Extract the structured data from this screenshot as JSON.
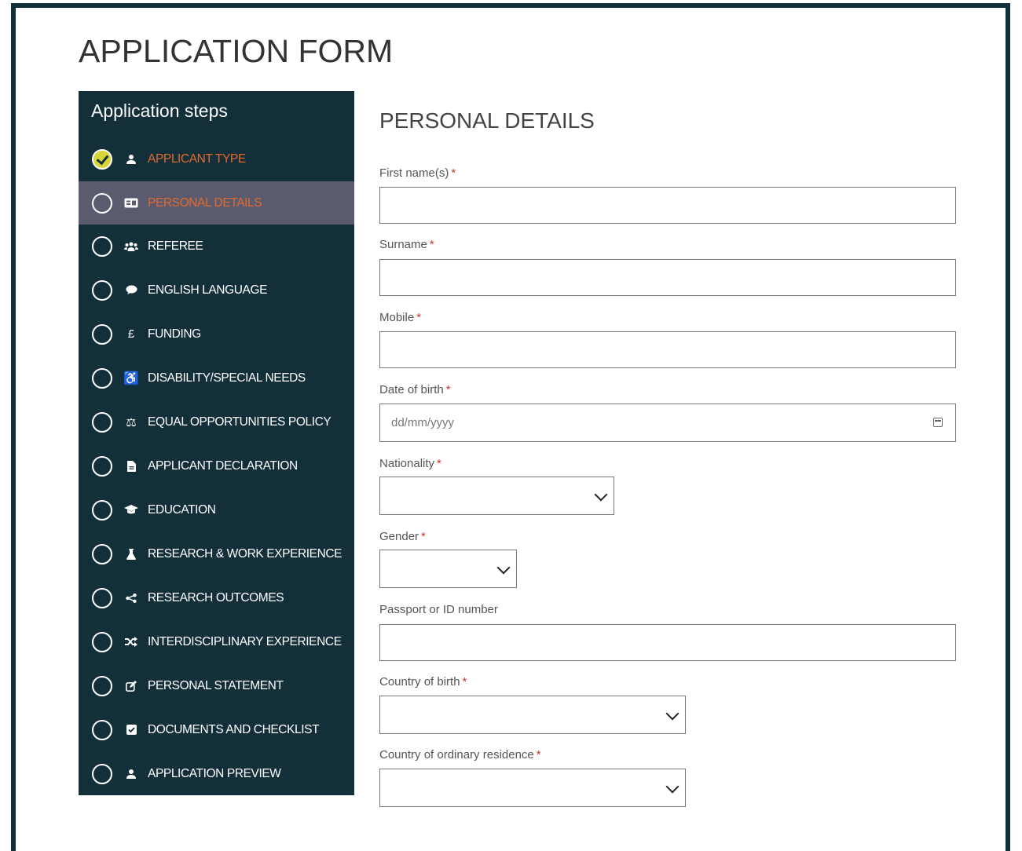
{
  "page": {
    "title": "APPLICATION FORM"
  },
  "sidebar": {
    "heading": "Application steps",
    "steps": [
      {
        "label": "APPLICANT TYPE",
        "icon": "user-icon",
        "status": "complete"
      },
      {
        "label": "PERSONAL DETAILS",
        "icon": "id-card-icon",
        "status": "active"
      },
      {
        "label": "REFEREE",
        "icon": "users-icon",
        "status": "incomplete"
      },
      {
        "label": "ENGLISH LANGUAGE",
        "icon": "comment-icon",
        "status": "incomplete"
      },
      {
        "label": "FUNDING",
        "icon": "pound-icon",
        "status": "incomplete"
      },
      {
        "label": "DISABILITY/SPECIAL NEEDS",
        "icon": "wheelchair-icon",
        "status": "incomplete"
      },
      {
        "label": "EQUAL OPPORTUNITIES POLICY",
        "icon": "balance-scale-icon",
        "status": "incomplete"
      },
      {
        "label": "APPLICANT DECLARATION",
        "icon": "file-icon",
        "status": "incomplete"
      },
      {
        "label": "EDUCATION",
        "icon": "graduation-cap-icon",
        "status": "incomplete"
      },
      {
        "label": "RESEARCH & WORK EXPERIENCE",
        "icon": "flask-icon",
        "status": "incomplete"
      },
      {
        "label": "RESEARCH OUTCOMES",
        "icon": "share-icon",
        "status": "incomplete"
      },
      {
        "label": "INTERDISCIPLINARY EXPERIENCE",
        "icon": "shuffle-icon",
        "status": "incomplete"
      },
      {
        "label": "PERSONAL STATEMENT",
        "icon": "edit-icon",
        "status": "incomplete"
      },
      {
        "label": "DOCUMENTS AND CHECKLIST",
        "icon": "check-square-icon",
        "status": "incomplete"
      },
      {
        "label": "APPLICATION PREVIEW",
        "icon": "user-icon",
        "status": "incomplete"
      }
    ]
  },
  "form": {
    "title": "PERSONAL DETAILS",
    "required_marker": "*",
    "fields": {
      "first_name": {
        "label": "First name(s)",
        "value": ""
      },
      "surname": {
        "label": "Surname",
        "value": ""
      },
      "mobile": {
        "label": "Mobile",
        "value": ""
      },
      "dob": {
        "label": "Date of birth",
        "placeholder": "dd/mm/yyyy"
      },
      "nationality": {
        "label": "Nationality",
        "value": ""
      },
      "gender": {
        "label": "Gender",
        "value": ""
      },
      "passport": {
        "label": "Passport or ID number",
        "value": ""
      },
      "country_birth": {
        "label": "Country of birth",
        "value": ""
      },
      "country_residence": {
        "label": "Country of ordinary residence",
        "value": ""
      }
    }
  },
  "colors": {
    "sidebar_bg": "#13303a",
    "active_step_bg": "#5a5b6f",
    "active_text": "#e36a2e",
    "complete_check": "#d6d638",
    "required": "#c0392b"
  }
}
